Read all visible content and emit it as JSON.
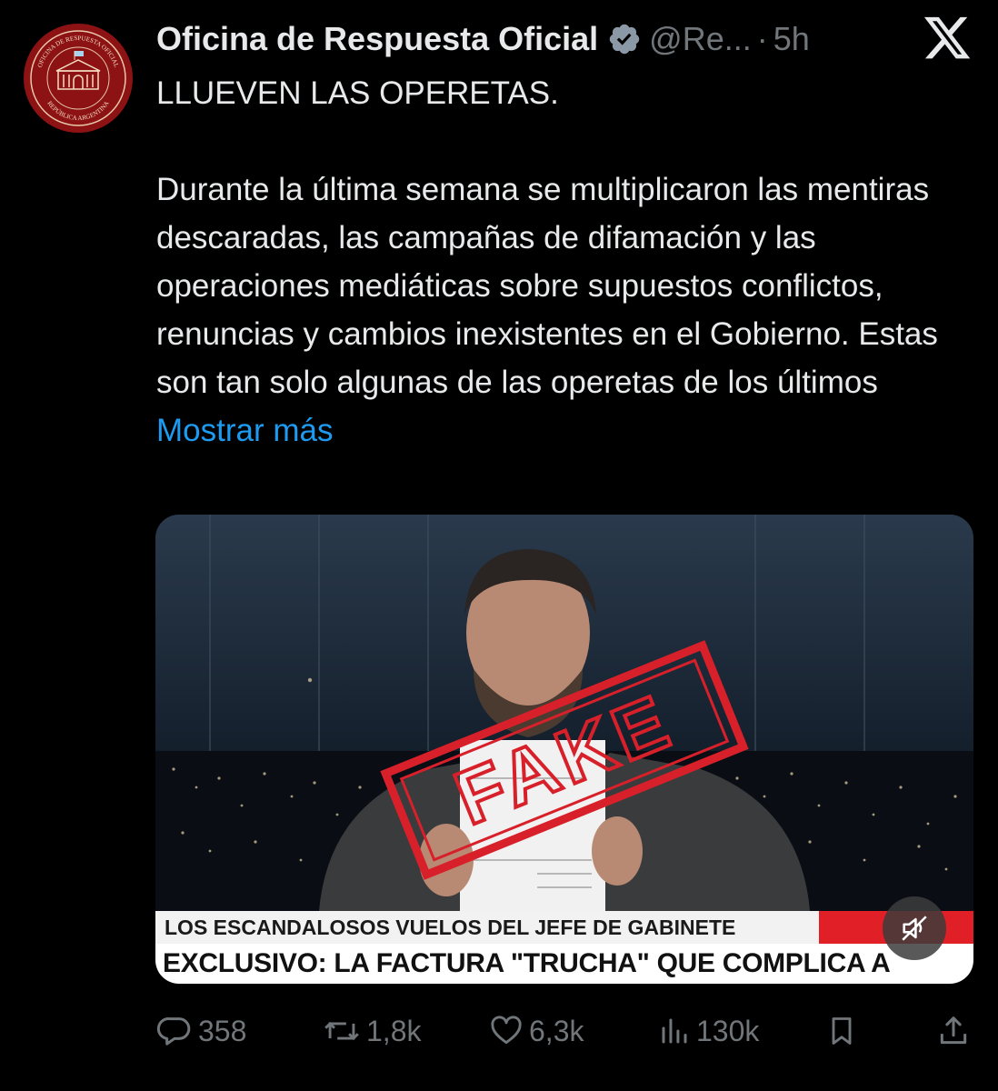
{
  "tweet": {
    "author": {
      "display_name": "Oficina de Respuesta Oficial",
      "handle": "@Re...",
      "time": "5h",
      "separator": "·",
      "avatar_text_top": "OFICINA DE RESPUESTA OFICIAL",
      "avatar_text_bottom": "REPÚBLICA ARGENTINA"
    },
    "title_line": "LLUEVEN LAS OPERETAS.",
    "body": "Durante la última semana se multiplicaron las mentiras descaradas, las campañas de difamación y las operaciones mediáticas sobre supuestos conflictos, renuncias y cambios inexistentes en el Gobierno. Estas son tan solo algunas de las operetas de los últimos",
    "show_more": "Mostrar más"
  },
  "media": {
    "stamp_text": "FAKE",
    "ticker_text": "LOS ESCANDALOSOS VUELOS DEL JEFE DE GABINETE",
    "headline_text": "EXCLUSIVO: LA FACTURA \"TRUCHA\" QUE COMPLICA A ADORNI"
  },
  "actions": {
    "replies": "358",
    "reposts": "1,8k",
    "likes": "6,3k",
    "views": "130k"
  },
  "icons": {
    "verified": "verified-badge-icon",
    "x_logo": "x-logo-icon",
    "reply": "reply-icon",
    "repost": "repost-icon",
    "like": "heart-icon",
    "views": "views-icon",
    "bookmark": "bookmark-icon",
    "share": "share-icon",
    "mute": "speaker-muted-icon"
  },
  "colors": {
    "background": "#000000",
    "text": "#e7e9ea",
    "muted": "#71767b",
    "link": "#1d9bf0",
    "avatar": "#8c1214",
    "stamp": "#d8202a"
  }
}
